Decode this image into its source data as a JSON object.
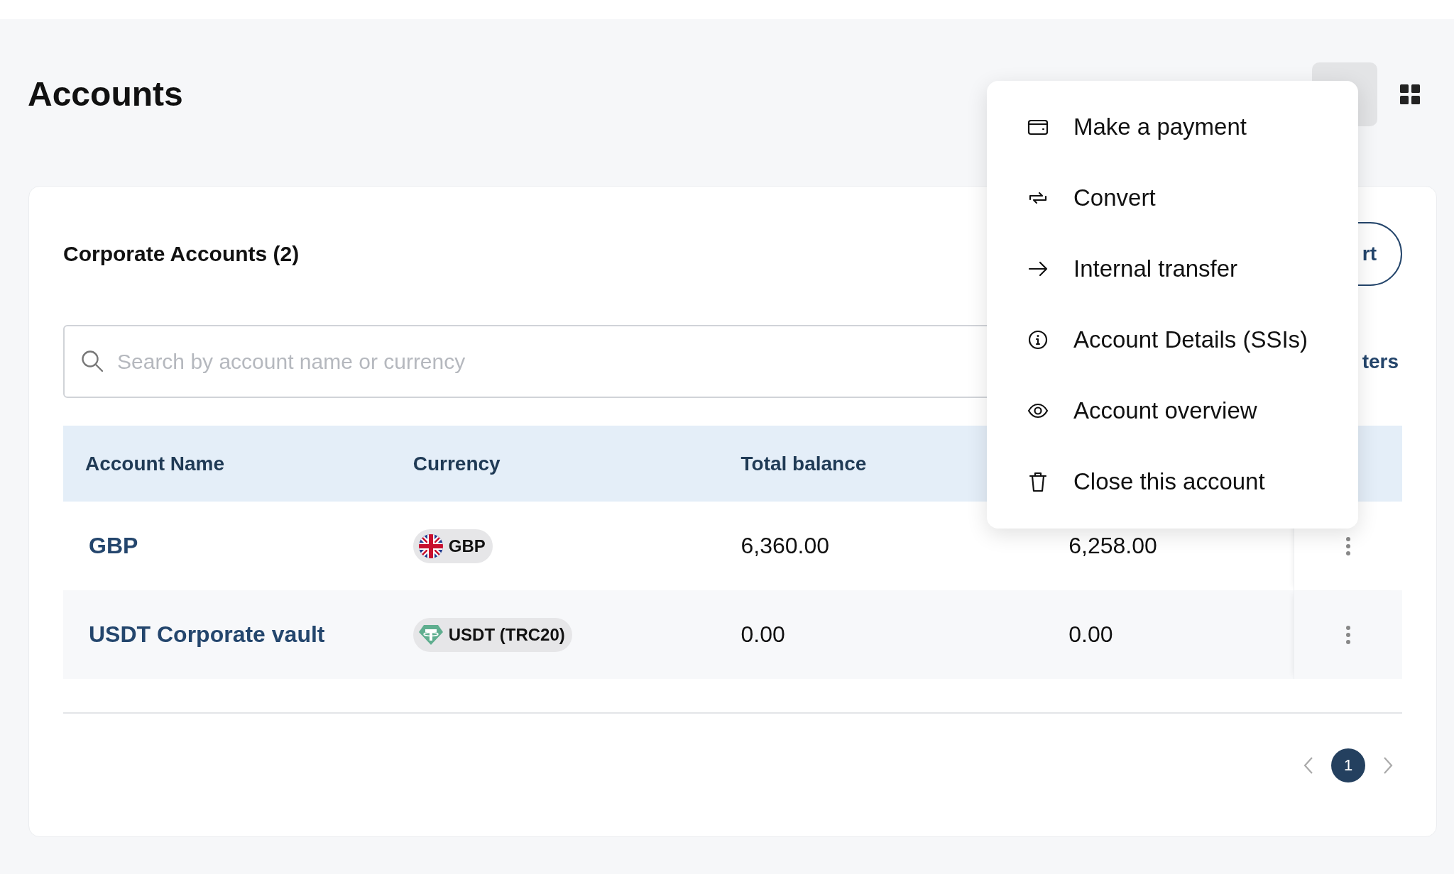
{
  "page": {
    "title": "Accounts"
  },
  "card": {
    "title": "Corporate Accounts (2)",
    "action_button": "rt",
    "search": {
      "placeholder": "Search by account name or currency"
    },
    "filters_link": "ters"
  },
  "table": {
    "columns": [
      "Account Name",
      "Currency",
      "Total balance"
    ],
    "rows": [
      {
        "name": "GBP",
        "currency": {
          "kind": "flag",
          "label": "GBP"
        },
        "total_balance": "6,360.00",
        "column_4": "6,258.00"
      },
      {
        "name": "USDT Corporate vault",
        "currency": {
          "kind": "tether",
          "label": "USDT (TRC20)"
        },
        "total_balance": "0.00",
        "column_4": "0.00"
      }
    ]
  },
  "pagination": {
    "pages": [
      {
        "label": "1",
        "selected": true
      }
    ]
  },
  "menu": {
    "items": [
      {
        "kind": "wallet",
        "label": "Make a payment"
      },
      {
        "kind": "convert",
        "label": "Convert"
      },
      {
        "kind": "arrow",
        "label": "Internal transfer"
      },
      {
        "kind": "info",
        "label": "Account Details (SSIs)"
      },
      {
        "kind": "eye",
        "label": "Account overview"
      },
      {
        "kind": "trash",
        "label": "Close this account"
      }
    ]
  }
}
